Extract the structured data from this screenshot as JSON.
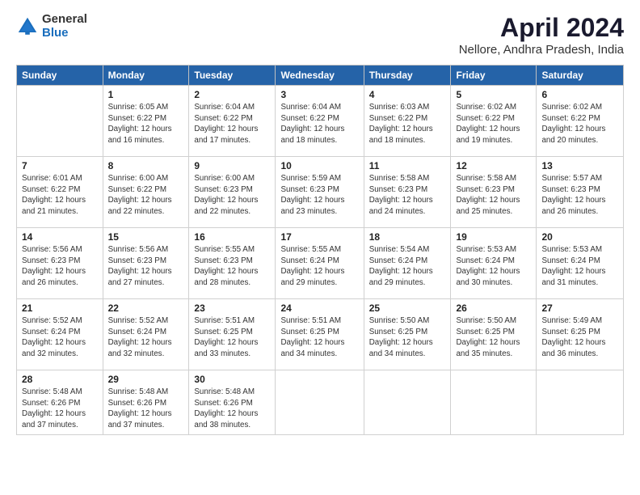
{
  "header": {
    "logo_general": "General",
    "logo_blue": "Blue",
    "title": "April 2024",
    "location": "Nellore, Andhra Pradesh, India"
  },
  "days_of_week": [
    "Sunday",
    "Monday",
    "Tuesday",
    "Wednesday",
    "Thursday",
    "Friday",
    "Saturday"
  ],
  "weeks": [
    [
      {
        "day": "",
        "info": ""
      },
      {
        "day": "1",
        "info": "Sunrise: 6:05 AM\nSunset: 6:22 PM\nDaylight: 12 hours\nand 16 minutes."
      },
      {
        "day": "2",
        "info": "Sunrise: 6:04 AM\nSunset: 6:22 PM\nDaylight: 12 hours\nand 17 minutes."
      },
      {
        "day": "3",
        "info": "Sunrise: 6:04 AM\nSunset: 6:22 PM\nDaylight: 12 hours\nand 18 minutes."
      },
      {
        "day": "4",
        "info": "Sunrise: 6:03 AM\nSunset: 6:22 PM\nDaylight: 12 hours\nand 18 minutes."
      },
      {
        "day": "5",
        "info": "Sunrise: 6:02 AM\nSunset: 6:22 PM\nDaylight: 12 hours\nand 19 minutes."
      },
      {
        "day": "6",
        "info": "Sunrise: 6:02 AM\nSunset: 6:22 PM\nDaylight: 12 hours\nand 20 minutes."
      }
    ],
    [
      {
        "day": "7",
        "info": "Sunrise: 6:01 AM\nSunset: 6:22 PM\nDaylight: 12 hours\nand 21 minutes."
      },
      {
        "day": "8",
        "info": "Sunrise: 6:00 AM\nSunset: 6:22 PM\nDaylight: 12 hours\nand 22 minutes."
      },
      {
        "day": "9",
        "info": "Sunrise: 6:00 AM\nSunset: 6:23 PM\nDaylight: 12 hours\nand 22 minutes."
      },
      {
        "day": "10",
        "info": "Sunrise: 5:59 AM\nSunset: 6:23 PM\nDaylight: 12 hours\nand 23 minutes."
      },
      {
        "day": "11",
        "info": "Sunrise: 5:58 AM\nSunset: 6:23 PM\nDaylight: 12 hours\nand 24 minutes."
      },
      {
        "day": "12",
        "info": "Sunrise: 5:58 AM\nSunset: 6:23 PM\nDaylight: 12 hours\nand 25 minutes."
      },
      {
        "day": "13",
        "info": "Sunrise: 5:57 AM\nSunset: 6:23 PM\nDaylight: 12 hours\nand 26 minutes."
      }
    ],
    [
      {
        "day": "14",
        "info": "Sunrise: 5:56 AM\nSunset: 6:23 PM\nDaylight: 12 hours\nand 26 minutes."
      },
      {
        "day": "15",
        "info": "Sunrise: 5:56 AM\nSunset: 6:23 PM\nDaylight: 12 hours\nand 27 minutes."
      },
      {
        "day": "16",
        "info": "Sunrise: 5:55 AM\nSunset: 6:23 PM\nDaylight: 12 hours\nand 28 minutes."
      },
      {
        "day": "17",
        "info": "Sunrise: 5:55 AM\nSunset: 6:24 PM\nDaylight: 12 hours\nand 29 minutes."
      },
      {
        "day": "18",
        "info": "Sunrise: 5:54 AM\nSunset: 6:24 PM\nDaylight: 12 hours\nand 29 minutes."
      },
      {
        "day": "19",
        "info": "Sunrise: 5:53 AM\nSunset: 6:24 PM\nDaylight: 12 hours\nand 30 minutes."
      },
      {
        "day": "20",
        "info": "Sunrise: 5:53 AM\nSunset: 6:24 PM\nDaylight: 12 hours\nand 31 minutes."
      }
    ],
    [
      {
        "day": "21",
        "info": "Sunrise: 5:52 AM\nSunset: 6:24 PM\nDaylight: 12 hours\nand 32 minutes."
      },
      {
        "day": "22",
        "info": "Sunrise: 5:52 AM\nSunset: 6:24 PM\nDaylight: 12 hours\nand 32 minutes."
      },
      {
        "day": "23",
        "info": "Sunrise: 5:51 AM\nSunset: 6:25 PM\nDaylight: 12 hours\nand 33 minutes."
      },
      {
        "day": "24",
        "info": "Sunrise: 5:51 AM\nSunset: 6:25 PM\nDaylight: 12 hours\nand 34 minutes."
      },
      {
        "day": "25",
        "info": "Sunrise: 5:50 AM\nSunset: 6:25 PM\nDaylight: 12 hours\nand 34 minutes."
      },
      {
        "day": "26",
        "info": "Sunrise: 5:50 AM\nSunset: 6:25 PM\nDaylight: 12 hours\nand 35 minutes."
      },
      {
        "day": "27",
        "info": "Sunrise: 5:49 AM\nSunset: 6:25 PM\nDaylight: 12 hours\nand 36 minutes."
      }
    ],
    [
      {
        "day": "28",
        "info": "Sunrise: 5:48 AM\nSunset: 6:26 PM\nDaylight: 12 hours\nand 37 minutes."
      },
      {
        "day": "29",
        "info": "Sunrise: 5:48 AM\nSunset: 6:26 PM\nDaylight: 12 hours\nand 37 minutes."
      },
      {
        "day": "30",
        "info": "Sunrise: 5:48 AM\nSunset: 6:26 PM\nDaylight: 12 hours\nand 38 minutes."
      },
      {
        "day": "",
        "info": ""
      },
      {
        "day": "",
        "info": ""
      },
      {
        "day": "",
        "info": ""
      },
      {
        "day": "",
        "info": ""
      }
    ]
  ]
}
